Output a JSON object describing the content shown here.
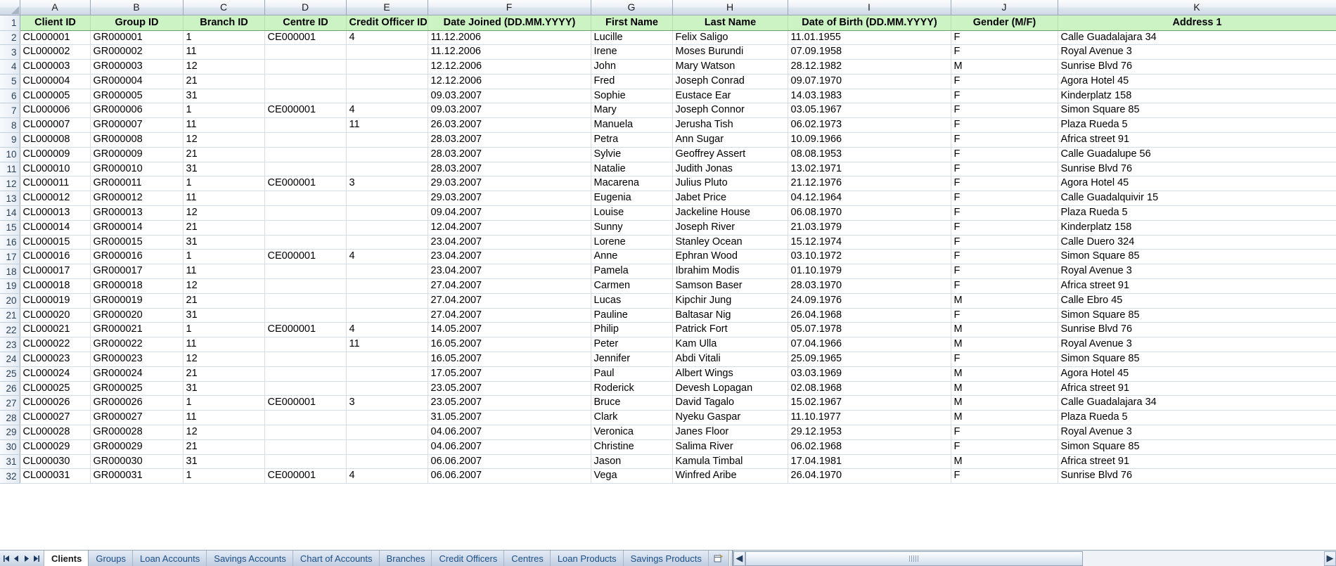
{
  "app": {
    "type": "spreadsheet",
    "active_sheet": "Clients",
    "colors": {
      "header_fill": "#ccf3c4",
      "gutter_fill": "#e8eef7",
      "grid_line": "#d6dce4",
      "tab_text": "#1c4f86"
    }
  },
  "grid": {
    "column_letters": [
      "A",
      "B",
      "C",
      "D",
      "E",
      "F",
      "G",
      "H",
      "I",
      "J",
      "K"
    ],
    "corner_select_all": "select-all-corner",
    "row_numbers": [
      1,
      2,
      3,
      4,
      5,
      6,
      7,
      8,
      9,
      10,
      11,
      12,
      13,
      14,
      15,
      16,
      17,
      18,
      19,
      20,
      21,
      22,
      23,
      24,
      25,
      26,
      27,
      28,
      29,
      30,
      31,
      32
    ],
    "headers": [
      "Client ID",
      "Group ID",
      "Branch ID",
      "Centre ID",
      "Credit Officer ID",
      "Date Joined (DD.MM.YYYY)",
      "First Name",
      "Last Name",
      "Date of Birth (DD.MM.YYYY)",
      "Gender (M/F)",
      "Address 1"
    ],
    "rows": [
      [
        "CL000001",
        "GR000001",
        "1",
        "CE000001",
        "4",
        "11.12.2006",
        "Lucille",
        "Felix Saligo",
        "11.01.1955",
        "F",
        "Calle Guadalajara 34"
      ],
      [
        "CL000002",
        "GR000002",
        "11",
        "",
        "",
        "11.12.2006",
        "Irene",
        "Moses Burundi",
        "07.09.1958",
        "F",
        "Royal Avenue 3"
      ],
      [
        "CL000003",
        "GR000003",
        "12",
        "",
        "",
        "12.12.2006",
        "John",
        "Mary Watson",
        "28.12.1982",
        "M",
        "Sunrise Blvd 76"
      ],
      [
        "CL000004",
        "GR000004",
        "21",
        "",
        "",
        "12.12.2006",
        "Fred",
        "Joseph Conrad",
        "09.07.1970",
        "F",
        "Agora Hotel 45"
      ],
      [
        "CL000005",
        "GR000005",
        "31",
        "",
        "",
        "09.03.2007",
        "Sophie",
        "Eustace Ear",
        "14.03.1983",
        "F",
        "Kinderplatz 158"
      ],
      [
        "CL000006",
        "GR000006",
        "1",
        "CE000001",
        "4",
        "09.03.2007",
        "Mary",
        "Joseph Connor",
        "03.05.1967",
        "F",
        "Simon Square 85"
      ],
      [
        "CL000007",
        "GR000007",
        "11",
        "",
        "11",
        "26.03.2007",
        "Manuela",
        "Jerusha Tish",
        "06.02.1973",
        "F",
        "Plaza Rueda 5"
      ],
      [
        "CL000008",
        "GR000008",
        "12",
        "",
        "",
        "28.03.2007",
        "Petra",
        "Ann Sugar",
        "10.09.1966",
        "F",
        "Africa street 91"
      ],
      [
        "CL000009",
        "GR000009",
        "21",
        "",
        "",
        "28.03.2007",
        "Sylvie",
        "Geoffrey Assert",
        "08.08.1953",
        "F",
        "Calle Guadalupe 56"
      ],
      [
        "CL000010",
        "GR000010",
        "31",
        "",
        "",
        "28.03.2007",
        "Natalie",
        "Judith Jonas",
        "13.02.1971",
        "F",
        "Sunrise Blvd 76"
      ],
      [
        "CL000011",
        "GR000011",
        "1",
        "CE000001",
        "3",
        "29.03.2007",
        "Macarena",
        "Julius Pluto",
        "21.12.1976",
        "F",
        "Agora Hotel 45"
      ],
      [
        "CL000012",
        "GR000012",
        "11",
        "",
        "",
        "29.03.2007",
        "Eugenia",
        "Jabet Price",
        "04.12.1964",
        "F",
        "Calle Guadalquivir 15"
      ],
      [
        "CL000013",
        "GR000013",
        "12",
        "",
        "",
        "09.04.2007",
        "Louise",
        "Jackeline House",
        "06.08.1970",
        "F",
        "Plaza Rueda 5"
      ],
      [
        "CL000014",
        "GR000014",
        "21",
        "",
        "",
        "12.04.2007",
        "Sunny",
        "Joseph River",
        "21.03.1979",
        "F",
        "Kinderplatz 158"
      ],
      [
        "CL000015",
        "GR000015",
        "31",
        "",
        "",
        "23.04.2007",
        "Lorene",
        "Stanley Ocean",
        "15.12.1974",
        "F",
        "Calle Duero 324"
      ],
      [
        "CL000016",
        "GR000016",
        "1",
        "CE000001",
        "4",
        "23.04.2007",
        "Anne",
        "Ephran Wood",
        "03.10.1972",
        "F",
        "Simon Square 85"
      ],
      [
        "CL000017",
        "GR000017",
        "11",
        "",
        "",
        "23.04.2007",
        "Pamela",
        "Ibrahim Modis",
        "01.10.1979",
        "F",
        "Royal Avenue 3"
      ],
      [
        "CL000018",
        "GR000018",
        "12",
        "",
        "",
        "27.04.2007",
        "Carmen",
        "Samson Baser",
        "28.03.1970",
        "F",
        "Africa street 91"
      ],
      [
        "CL000019",
        "GR000019",
        "21",
        "",
        "",
        "27.04.2007",
        "Lucas",
        "Kipchir Jung",
        "24.09.1976",
        "M",
        "Calle Ebro 45"
      ],
      [
        "CL000020",
        "GR000020",
        "31",
        "",
        "",
        "27.04.2007",
        "Pauline",
        "Baltasar Nig",
        "26.04.1968",
        "F",
        "Simon Square 85"
      ],
      [
        "CL000021",
        "GR000021",
        "1",
        "CE000001",
        "4",
        "14.05.2007",
        "Philip",
        "Patrick Fort",
        "05.07.1978",
        "M",
        "Sunrise Blvd 76"
      ],
      [
        "CL000022",
        "GR000022",
        "11",
        "",
        "11",
        "16.05.2007",
        "Peter",
        "Kam Ulla",
        "07.04.1966",
        "M",
        "Royal Avenue 3"
      ],
      [
        "CL000023",
        "GR000023",
        "12",
        "",
        "",
        "16.05.2007",
        "Jennifer",
        "Abdi Vitali",
        "25.09.1965",
        "F",
        "Simon Square 85"
      ],
      [
        "CL000024",
        "GR000024",
        "21",
        "",
        "",
        "17.05.2007",
        "Paul",
        "Albert Wings",
        "03.03.1969",
        "M",
        "Agora Hotel 45"
      ],
      [
        "CL000025",
        "GR000025",
        "31",
        "",
        "",
        "23.05.2007",
        "Roderick",
        "Devesh Lopagan",
        "02.08.1968",
        "M",
        "Africa street 91"
      ],
      [
        "CL000026",
        "GR000026",
        "1",
        "CE000001",
        "3",
        "23.05.2007",
        "Bruce",
        "David Tagalo",
        "15.02.1967",
        "M",
        "Calle Guadalajara 34"
      ],
      [
        "CL000027",
        "GR000027",
        "11",
        "",
        "",
        "31.05.2007",
        "Clark",
        "Nyeku Gaspar",
        "11.10.1977",
        "M",
        "Plaza Rueda 5"
      ],
      [
        "CL000028",
        "GR000028",
        "12",
        "",
        "",
        "04.06.2007",
        "Veronica",
        "Janes Floor",
        "29.12.1953",
        "F",
        "Royal Avenue 3"
      ],
      [
        "CL000029",
        "GR000029",
        "21",
        "",
        "",
        "04.06.2007",
        "Christine",
        "Salima River",
        "06.02.1968",
        "F",
        "Simon Square 85"
      ],
      [
        "CL000030",
        "GR000030",
        "31",
        "",
        "",
        "06.06.2007",
        "Jason",
        "Kamula Timbal",
        "17.04.1981",
        "M",
        "Africa street 91"
      ],
      [
        "CL000031",
        "GR000031",
        "1",
        "CE000001",
        "4",
        "06.06.2007",
        "Vega",
        "Winfred Aribe",
        "26.04.1970",
        "F",
        "Sunrise Blvd 76"
      ]
    ]
  },
  "tabbar": {
    "nav_buttons": [
      "first-sheet",
      "previous-sheet",
      "next-sheet",
      "last-sheet"
    ],
    "sheets": [
      "Clients",
      "Groups",
      "Loan Accounts",
      "Savings Accounts",
      "Chart of Accounts",
      "Branches",
      "Credit Officers",
      "Centres",
      "Loan Products",
      "Savings Products"
    ],
    "insert_sheet_label": "",
    "scroll_left_label": "◀",
    "scroll_right_label": "▶"
  }
}
